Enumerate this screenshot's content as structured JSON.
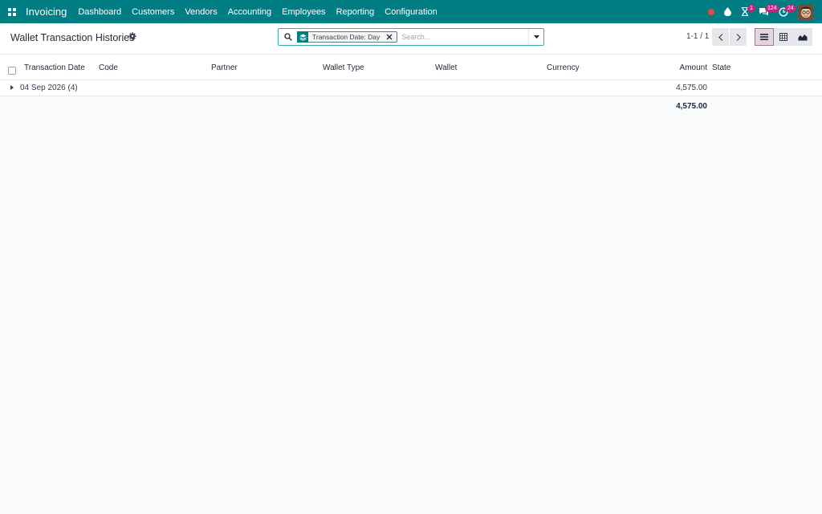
{
  "navbar": {
    "brand": "Invoicing",
    "menu": [
      "Dashboard",
      "Customers",
      "Vendors",
      "Accounting",
      "Employees",
      "Reporting",
      "Configuration"
    ],
    "badges": {
      "activities": "1",
      "messages": "124",
      "updates": "24"
    }
  },
  "control_panel": {
    "title": "Wallet Transaction Histories",
    "facet_label": "Transaction Date: Day",
    "search_placeholder": "Search...",
    "pager": "1-1 / 1"
  },
  "list": {
    "columns": {
      "transaction_date": "Transaction Date",
      "code": "Code",
      "partner": "Partner",
      "wallet_type": "Wallet Type",
      "wallet": "Wallet",
      "currency": "Currency",
      "amount": "Amount",
      "state": "State"
    },
    "groups": [
      {
        "label": "04 Sep 2026 (4)",
        "amount": "4,575.00"
      }
    ],
    "total_amount": "4,575.00"
  },
  "colors": {
    "navbar": "#017e84",
    "accent": "#c0267d"
  }
}
